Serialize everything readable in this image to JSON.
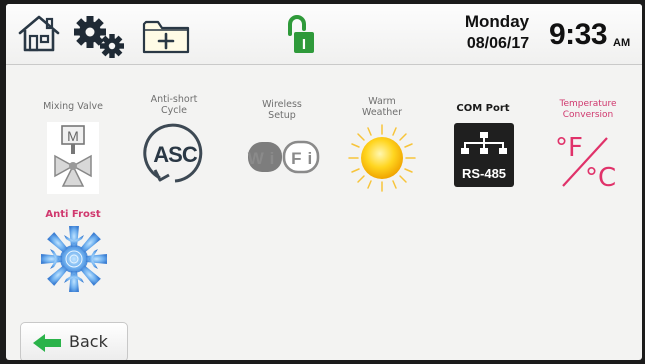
{
  "header": {
    "home_icon": "home-icon",
    "settings_icon": "gear-icon",
    "add_folder_icon": "add-folder-icon",
    "lock_icon": "unlocked-padlock-icon",
    "lock_letter": "I",
    "day": "Monday",
    "date": "08/06/17",
    "time": "9:33",
    "ampm": "AM"
  },
  "apps": [
    {
      "label": "Mixing Valve",
      "icon": "mixing-valve-icon",
      "valve_letter": "M"
    },
    {
      "label": "Anti-short\nCycle",
      "icon": "anti-short-cycle-icon",
      "icon_text": "ASC"
    },
    {
      "label": "Wireless\nSetup",
      "icon": "wifi-icon",
      "icon_text": "Wi Fi"
    },
    {
      "label": "Warm\nWeather",
      "icon": "sun-icon"
    },
    {
      "label": "COM Port",
      "icon": "rs485-port-icon",
      "icon_text": "RS-485"
    },
    {
      "label": "Temperature\nConversion",
      "icon": "temperature-conversion-icon",
      "icon_text_f": "°F",
      "icon_text_c": "°C"
    },
    {
      "label": "Anti Frost",
      "icon": "snowflake-icon"
    }
  ],
  "footer": {
    "back_label": "Back",
    "back_icon": "back-arrow-icon"
  },
  "colors": {
    "lock_green": "#2f9a3a",
    "label_pink": "#d0386e",
    "accent_green": "#2bb34a",
    "frost_blue": "#6fb0ef"
  }
}
